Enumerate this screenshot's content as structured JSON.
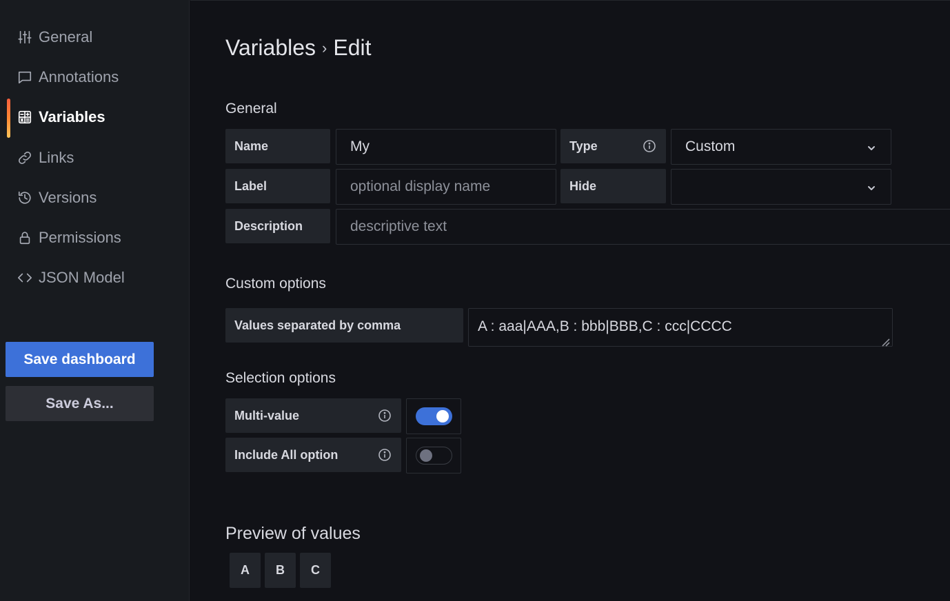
{
  "sidebar": {
    "items": [
      {
        "label": "General",
        "icon": "sliders-icon",
        "active": false
      },
      {
        "label": "Annotations",
        "icon": "comment-icon",
        "active": false
      },
      {
        "label": "Variables",
        "icon": "calculator-icon",
        "active": true
      },
      {
        "label": "Links",
        "icon": "link-icon",
        "active": false
      },
      {
        "label": "Versions",
        "icon": "history-icon",
        "active": false
      },
      {
        "label": "Permissions",
        "icon": "lock-icon",
        "active": false
      },
      {
        "label": "JSON Model",
        "icon": "code-icon",
        "active": false
      }
    ],
    "save_button": "Save dashboard",
    "save_as_button": "Save As..."
  },
  "header": {
    "crumb_parent": "Variables",
    "separator": "›",
    "crumb_current": "Edit"
  },
  "general": {
    "section_title": "General",
    "name_label": "Name",
    "name_value": "My",
    "type_label": "Type",
    "type_value": "Custom",
    "label_label": "Label",
    "label_placeholder": "optional display name",
    "hide_label": "Hide",
    "hide_value": "",
    "description_label": "Description",
    "description_placeholder": "descriptive text"
  },
  "custom_options": {
    "section_title": "Custom options",
    "values_label": "Values separated by comma",
    "values_value": "A : aaa|AAA,B : bbb|BBB,C : ccc|CCCC"
  },
  "selection_options": {
    "section_title": "Selection options",
    "multi_value_label": "Multi-value",
    "multi_value_enabled": true,
    "include_all_label": "Include All option",
    "include_all_enabled": false
  },
  "preview": {
    "section_title": "Preview of values",
    "values": [
      "A",
      "B",
      "C"
    ]
  },
  "colors": {
    "accent_blue": "#3d71d9",
    "active_indicator": "#ff8833",
    "background": "#111217",
    "sidebar_background": "#181b1f"
  }
}
